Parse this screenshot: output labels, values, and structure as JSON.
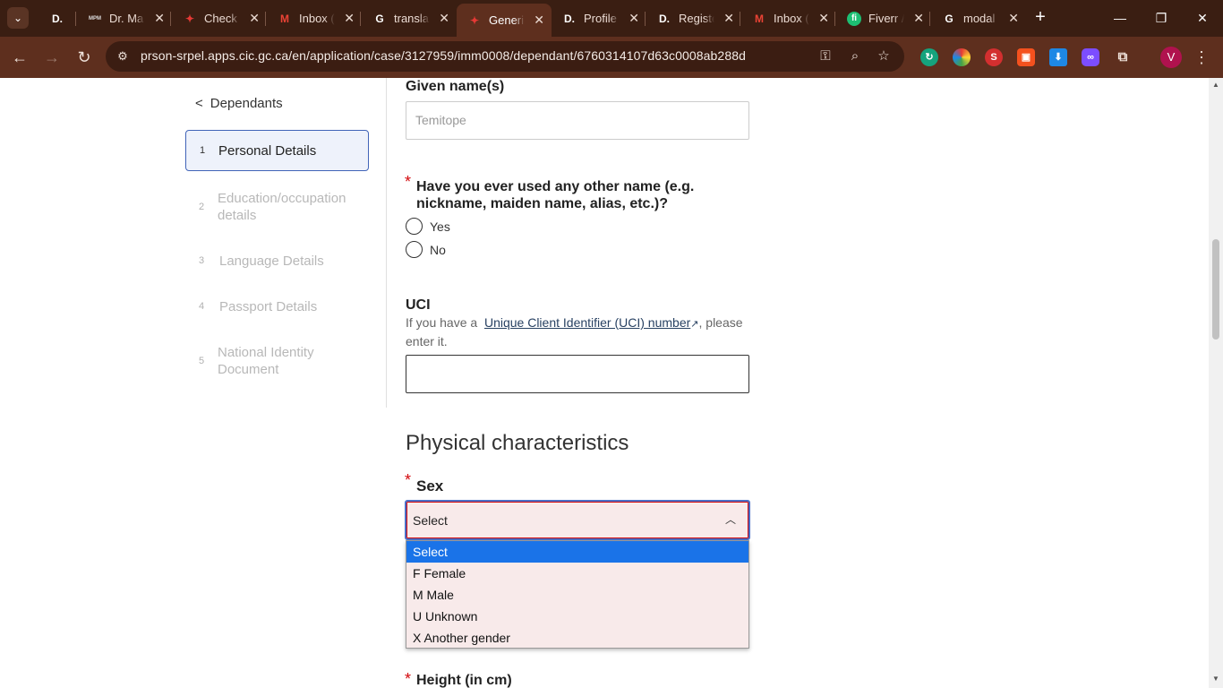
{
  "browser": {
    "tabs": [
      {
        "title": "",
        "favicon": "D."
      },
      {
        "title": "Dr. Ma",
        "favicon": "MPM"
      },
      {
        "title": "Check",
        "favicon": "maple-leaf"
      },
      {
        "title": "Inbox (",
        "favicon": "gmail"
      },
      {
        "title": "transla",
        "favicon": "google"
      },
      {
        "title": "Generi",
        "favicon": "maple-leaf",
        "active": true
      },
      {
        "title": "Profile",
        "favicon": "D."
      },
      {
        "title": "Registe",
        "favicon": "D."
      },
      {
        "title": "Inbox (",
        "favicon": "gmail"
      },
      {
        "title": "Fiverr /",
        "favicon": "fiverr"
      },
      {
        "title": "modal",
        "favicon": "google"
      }
    ],
    "url": "prson-srpel.apps.cic.gc.ca/en/application/case/3127959/imm0008/dependant/6760314107d63c0008ab288d",
    "profile_initial": "V"
  },
  "sidenav": {
    "back_label": "Dependants",
    "steps": [
      {
        "num": "1",
        "label": "Personal Details",
        "active": true
      },
      {
        "num": "2",
        "label": "Education/occupation details"
      },
      {
        "num": "3",
        "label": "Language Details"
      },
      {
        "num": "4",
        "label": "Passport Details"
      },
      {
        "num": "5",
        "label": "National Identity Document"
      }
    ]
  },
  "form": {
    "given_names_label": "Given name(s)",
    "given_names_value": "Temitope",
    "other_name_question": "Have you ever used any other name (e.g. nickname, maiden name, alias, etc.)?",
    "other_name_options": [
      "Yes",
      "No"
    ],
    "uci_label": "UCI",
    "uci_help_prefix": "If you have a",
    "uci_help_link": "Unique Client Identifier (UCI) number",
    "uci_help_suffix": ", please enter it.",
    "uci_value": "",
    "section_title": "Physical characteristics",
    "sex_label": "Sex",
    "sex_selected": "Select",
    "sex_options": [
      "Select",
      "F Female",
      "M Male",
      "U Unknown",
      "X Another gender"
    ],
    "height_label": "Height (in cm)"
  }
}
